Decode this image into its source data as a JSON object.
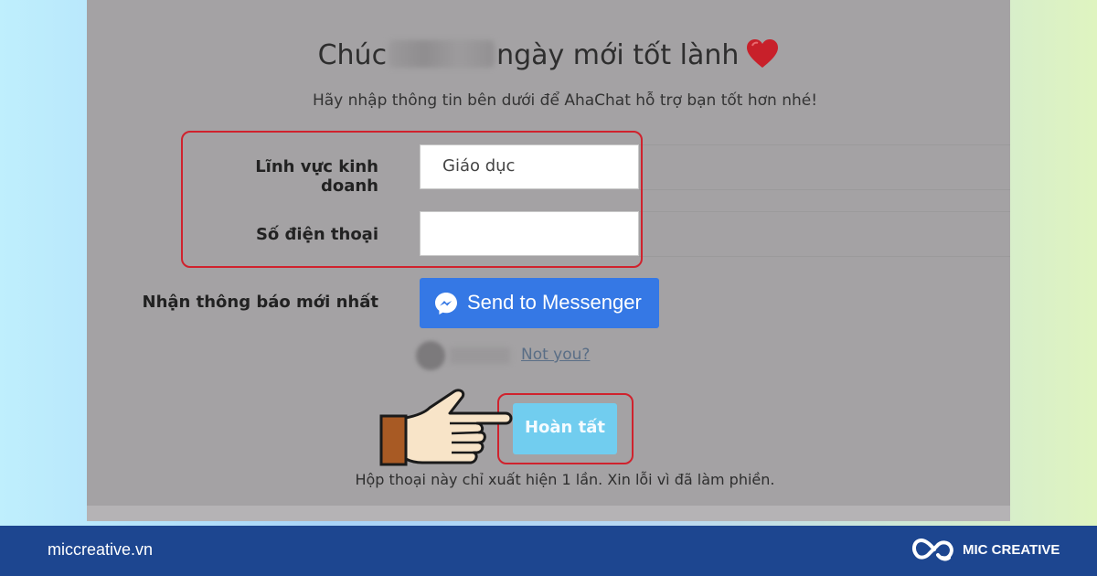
{
  "dialog": {
    "title_start": "Chúc",
    "title_end": "ngày mới tốt lành",
    "subtitle": "Hãy nhập thông tin bên dưới để AhaChat hỗ trợ bạn tốt hơn nhé!",
    "business_label": "Lĩnh vực kinh doanh",
    "business_value": "Giáo dục",
    "phone_label": "Số điện thoại",
    "phone_value": "",
    "notify_label": "Nhận thông báo mới nhất",
    "messenger_button": "Send to Messenger",
    "not_you": "Not you?",
    "done_button": "Hoàn tất",
    "footer_note": "Hộp thoại này chỉ xuất hiện 1 lần. Xin lỗi vì đã làm phiền."
  },
  "bottom_bar": {
    "website": "miccreative.vn",
    "brand": "MIC CREATIVE"
  },
  "icons": [
    "heart-icon",
    "messenger-icon",
    "pointing-hand-icon",
    "mic-creative-logo-icon"
  ],
  "colors": {
    "accent_red": "#d0222d",
    "messenger_blue": "#3578e5",
    "done_button": "#71cdef",
    "bottom_bar": "#1d4690"
  }
}
